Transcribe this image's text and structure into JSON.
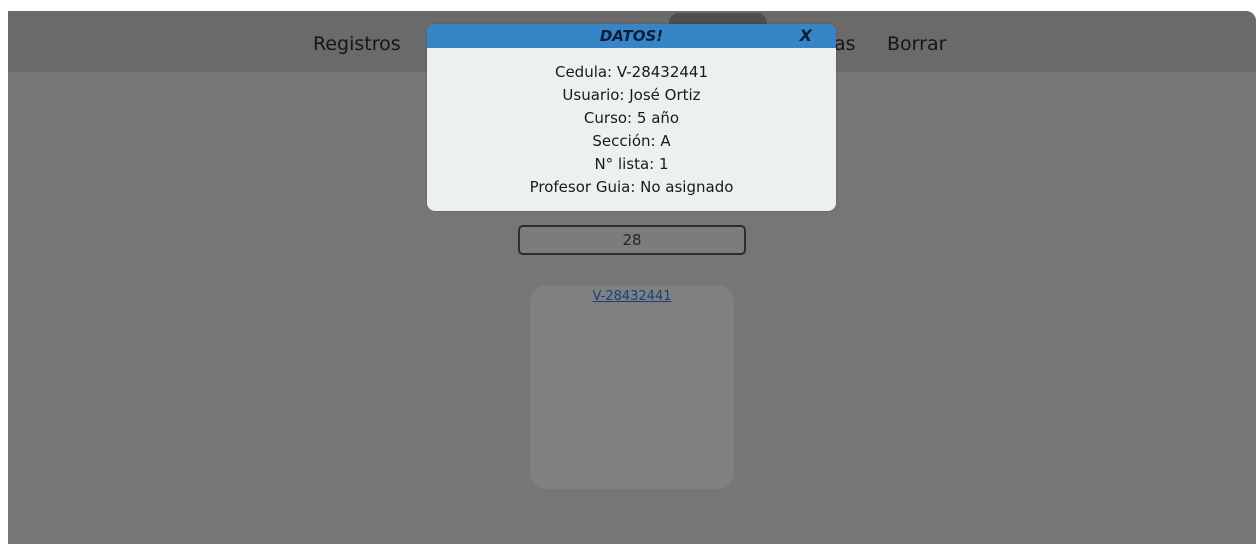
{
  "nav": {
    "registros": "Registros",
    "partial": "as",
    "borrar": "Borrar"
  },
  "search": {
    "value": "28"
  },
  "result_card": {
    "link": "V-28432441"
  },
  "modal": {
    "title": "DATOS!",
    "close": "X",
    "cedula": "Cedula: V-28432441",
    "usuario": "Usuario: José Ortiz",
    "curso": "Curso: 5 año",
    "seccion": "Sección: A",
    "lista": "N° lista: 1",
    "profesor": "Profesor Guia: No asignado"
  },
  "colors": {
    "overlay": "#767676",
    "modal_header": "#3784c6",
    "modal_body": "#ecf0f1",
    "link": "#17407a",
    "accent": "#1f8a80"
  }
}
